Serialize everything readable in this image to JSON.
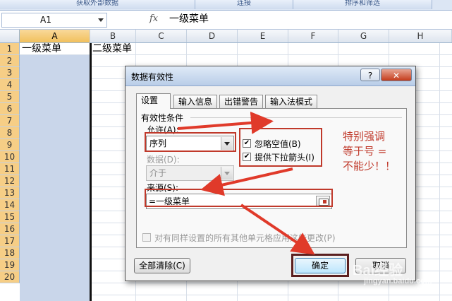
{
  "ribbon": {
    "groups": [
      "获取外部数据",
      "连接",
      "排序和筛选"
    ]
  },
  "formula_bar": {
    "name_box": "A1",
    "fx_label": "fx",
    "content": "一级菜单"
  },
  "sheet": {
    "columns": [
      "A",
      "B",
      "C",
      "D",
      "E",
      "F",
      "G",
      "H"
    ],
    "rows": [
      "1",
      "2",
      "3",
      "4",
      "5",
      "6",
      "7",
      "8",
      "9",
      "10",
      "11",
      "12",
      "13",
      "14",
      "15",
      "16",
      "17",
      "18",
      "19",
      "20"
    ],
    "cells": {
      "A1": "一级菜单",
      "B1": "二级菜单"
    }
  },
  "dialog": {
    "title": "数据有效性",
    "help_label": "?",
    "close_label": "✕",
    "tabs": [
      "设置",
      "输入信息",
      "出错警告",
      "输入法模式"
    ],
    "active_tab": "设置",
    "section_title": "有效性条件",
    "allow_label": "允许(A):",
    "allow_value": "序列",
    "data_label": "数据(D):",
    "data_value": "介于",
    "ignore_blank_label": "忽略空值(B)",
    "ignore_blank_checked": true,
    "dropdown_label": "提供下拉箭头(I)",
    "dropdown_checked": true,
    "source_label": "来源(S):",
    "source_value": "=一级菜单",
    "apply_all_label": "对有同样设置的所有其他单元格应用这些更改(P)",
    "apply_all_checked": false,
    "clear_all_label": "全部清除(C)",
    "ok_label": "确定",
    "cancel_label": "取消"
  },
  "annotation": {
    "note_lines": [
      "特别强调",
      "等于号 =",
      "不能少！！"
    ],
    "color": "#c0392b"
  },
  "watermark": {
    "main": "Bai经验",
    "sub": "jingyan.baidu.com"
  }
}
